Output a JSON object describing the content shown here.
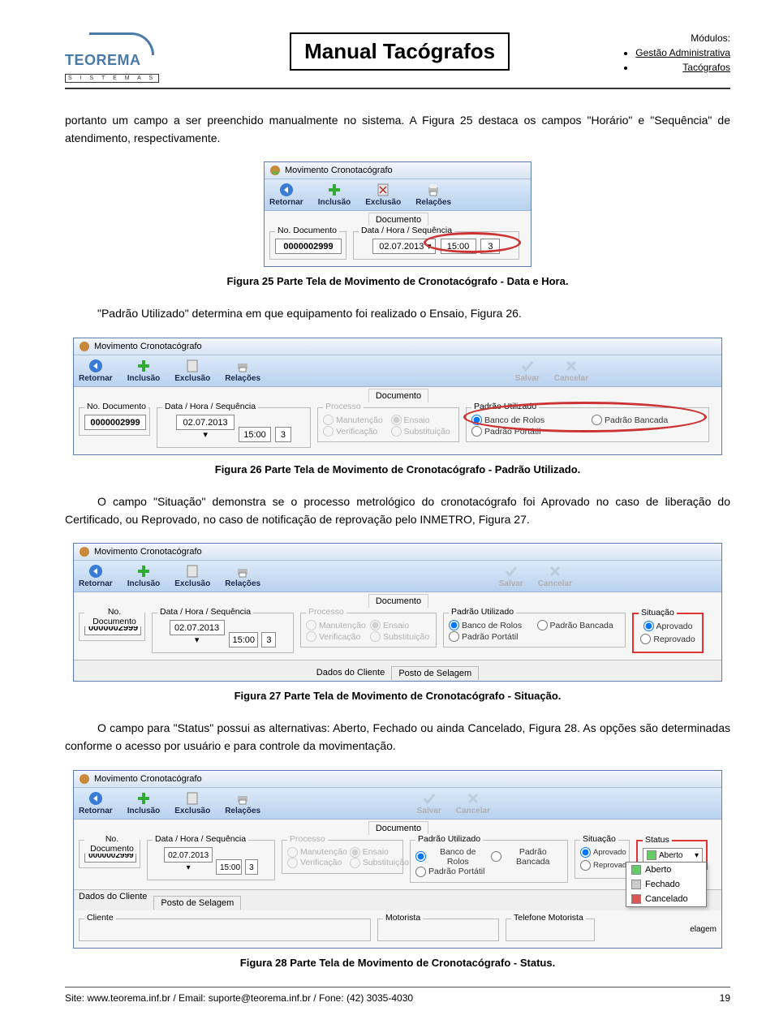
{
  "header": {
    "logo_main": "TEOREMA",
    "logo_sub": "S I S T E M A S",
    "title": "Manual Tacógrafos",
    "modules_h": "Módulos:",
    "modules": [
      "Gestão Administrativa",
      "Tacógrafos"
    ]
  },
  "body": {
    "p1": "portanto um campo a ser preenchido manualmente no sistema. A Figura 25 destaca os campos \"Horário\" e \"Sequência\" de atendimento, respectivamente.",
    "cap25": "Figura 25 Parte Tela de Movimento de Cronotacógrafo - Data e Hora.",
    "p2": "\"Padrão Utilizado\" determina em que equipamento foi realizado o Ensaio, Figura 26.",
    "cap26": "Figura 26 Parte Tela de Movimento de Cronotacógrafo - Padrão Utilizado.",
    "p3": "O campo \"Situação\" demonstra se o processo metrológico do cronotacógrafo foi Aprovado no caso de liberação do Certificado, ou Reprovado, no caso de notificação de reprovação pelo INMETRO, Figura 27.",
    "cap27": "Figura 27 Parte Tela de Movimento de Cronotacógrafo - Situação.",
    "p4": "O campo para \"Status\" possui as alternativas: Aberto, Fechado ou ainda Cancelado, Figura 28. As opções são determinadas conforme o acesso por usuário e para controle da movimentação.",
    "cap28": "Figura 28 Parte Tela de Movimento de Cronotacógrafo - Status."
  },
  "win": {
    "title": "Movimento Cronotacógrafo",
    "toolbar": {
      "retornar": "Retornar",
      "inclusao": "Inclusão",
      "exclusao": "Exclusão",
      "relacoes": "Relações",
      "salvar": "Salvar",
      "cancelar": "Cancelar"
    },
    "tab_doc": "Documento",
    "fs_no": "No. Documento",
    "fs_data": "Data / Hora / Sequência",
    "fs_proc": "Processo",
    "fs_padrao": "Padrão Utilizado",
    "fs_sit": "Situação",
    "fs_status": "Status",
    "no_doc": "0000002999",
    "data": "02.07.2013",
    "hora": "15:00",
    "seq": "3",
    "proc_man": "Manutenção",
    "proc_ens": "Ensaio",
    "proc_ver": "Verificação",
    "proc_sub": "Substituição",
    "pad_banco": "Banco de Rolos",
    "pad_bancada": "Padrão Bancada",
    "pad_portatil": "Padrão Portátil",
    "sit_apr": "Aprovado",
    "sit_rep": "Reprovado",
    "stat_apr": "Aprovado",
    "stat_rep": "Reprovado",
    "dados": "Dados do Cliente",
    "posto": "Posto de Selagem",
    "cliente": "Cliente",
    "motorista": "Motorista",
    "tel_mot": "Telefone Motorista",
    "elagem": "elagem",
    "status_opts": {
      "aberto": "Aberto",
      "fechado": "Fechado",
      "cancelado": "Cancelado"
    }
  },
  "footer": {
    "site": "Site: www.teorema.inf.br / Email: suporte@teorema.inf.br / Fone: (42) 3035-4030",
    "page": "19"
  }
}
